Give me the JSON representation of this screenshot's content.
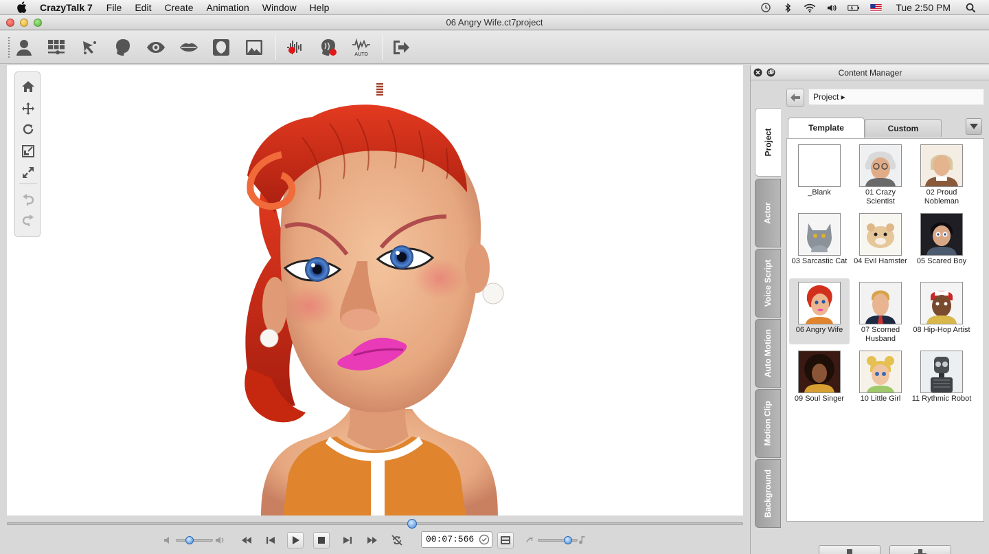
{
  "menubar": {
    "app_name": "CrazyTalk 7",
    "items": [
      "File",
      "Edit",
      "Create",
      "Animation",
      "Window",
      "Help"
    ],
    "clock": "Tue 2:50 PM"
  },
  "window": {
    "title": "06 Angry Wife.ct7project"
  },
  "toolbar": {
    "icons": [
      "actor-icon",
      "template-grid-icon",
      "face-fitting-icon",
      "head-icon",
      "eye-icon",
      "lips-icon",
      "face-mask-icon",
      "background-image-icon",
      "record-voice-icon",
      "face-puppet-icon",
      "auto-motion-icon",
      "export-icon"
    ],
    "auto_label": "AUTO"
  },
  "viewport": {
    "nav_tools": [
      "home-icon",
      "move-icon",
      "rotate-icon",
      "scale-icon",
      "fit-icon",
      "undo-icon",
      "redo-icon"
    ]
  },
  "timeline": {
    "position": 0.55
  },
  "playback": {
    "volume": 0.37,
    "speed": 0.77,
    "timecode": "00:07:566"
  },
  "content_manager": {
    "title": "Content Manager",
    "breadcrumb": "Project ▸",
    "tabs": [
      "Template",
      "Custom"
    ],
    "active_tab": "Template",
    "side_tabs": [
      "Project",
      "Actor",
      "Voice Script",
      "Auto Motion",
      "Motion Clip",
      "Background"
    ],
    "active_side_tab": "Project",
    "items": [
      {
        "label": "_Blank"
      },
      {
        "label": "01 Crazy Scientist"
      },
      {
        "label": "02 Proud Nobleman"
      },
      {
        "label": "03 Sarcastic Cat"
      },
      {
        "label": "04 Evil Hamster"
      },
      {
        "label": "05 Scared Boy"
      },
      {
        "label": "06 Angry Wife"
      },
      {
        "label": "07 Scorned Husband"
      },
      {
        "label": "08 Hip-Hop Artist"
      },
      {
        "label": "09 Soul Singer"
      },
      {
        "label": "10 Little Girl"
      },
      {
        "label": "11 Rythmic Robot"
      }
    ],
    "selected_item": "06 Angry Wife"
  },
  "colors": {
    "accent_blue": "#3d86d8",
    "record_red": "#e01818",
    "hair_red": "#d2301c"
  }
}
